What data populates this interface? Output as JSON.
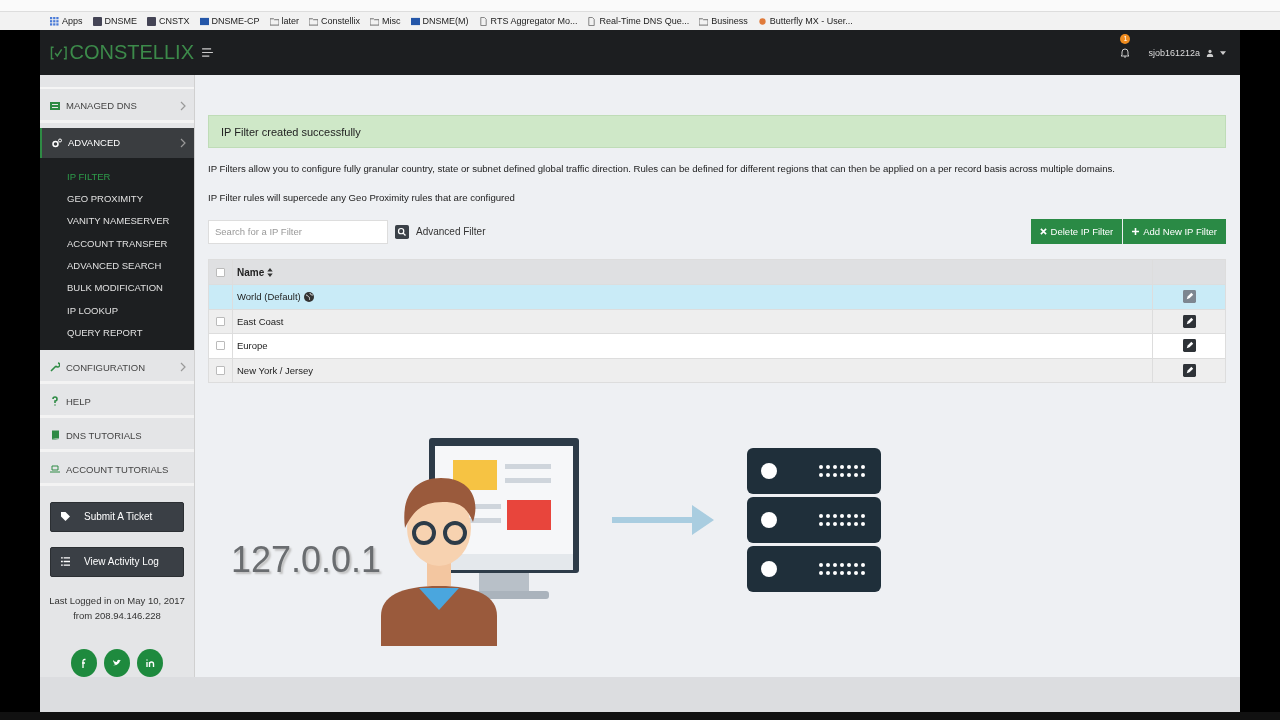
{
  "bookmarks": [
    {
      "label": "Apps",
      "kind": "apps"
    },
    {
      "label": "DNSME",
      "kind": "site"
    },
    {
      "label": "CNSTX",
      "kind": "site"
    },
    {
      "label": "DNSME-CP",
      "kind": "flag"
    },
    {
      "label": "later",
      "kind": "folder"
    },
    {
      "label": "Constellix",
      "kind": "folder"
    },
    {
      "label": "Misc",
      "kind": "folder"
    },
    {
      "label": "DNSME(M)",
      "kind": "flag"
    },
    {
      "label": "RTS Aggregator Mo...",
      "kind": "page"
    },
    {
      "label": "Real-Time DNS Que...",
      "kind": "page"
    },
    {
      "label": "Business",
      "kind": "folder"
    },
    {
      "label": "Butterfly MX - User...",
      "kind": "leaf"
    }
  ],
  "header": {
    "logo": "CONSTELLIX",
    "notification_count": "1",
    "user": "sjob161212a"
  },
  "sidebar": {
    "items": [
      {
        "label": "MANAGED DNS",
        "kind": "dns",
        "selected": false,
        "arrow": true
      },
      {
        "label": "ADVANCED",
        "kind": "advanced",
        "selected": true,
        "arrow": true,
        "children": [
          {
            "label": "IP FILTER",
            "selected": true
          },
          {
            "label": "GEO PROXIMITY",
            "selected": false
          },
          {
            "label": "VANITY NAMESERVER",
            "selected": false
          },
          {
            "label": "ACCOUNT TRANSFER",
            "selected": false
          },
          {
            "label": "ADVANCED SEARCH",
            "selected": false
          },
          {
            "label": "BULK MODIFICATION",
            "selected": false
          },
          {
            "label": "IP LOOKUP",
            "selected": false
          },
          {
            "label": "QUERY REPORT",
            "selected": false
          }
        ]
      },
      {
        "label": "CONFIGURATION",
        "kind": "config",
        "selected": false,
        "arrow": true
      },
      {
        "label": "HELP",
        "kind": "help",
        "selected": false,
        "arrow": false
      },
      {
        "label": "DNS TUTORIALS",
        "kind": "book",
        "selected": false,
        "arrow": false
      },
      {
        "label": "ACCOUNT TUTORIALS",
        "kind": "laptop",
        "selected": false,
        "arrow": false
      }
    ],
    "buttons": [
      {
        "label": "Submit A Ticket",
        "kind": "ticket"
      },
      {
        "label": "View Activity Log",
        "kind": "log"
      }
    ],
    "last_login": "Last Logged in on May 10, 2017 from 208.94.146.228",
    "social": [
      {
        "kind": "facebook"
      },
      {
        "kind": "twitter"
      },
      {
        "kind": "linkedin"
      }
    ]
  },
  "alert": "IP Filter created successfully",
  "description": [
    "IP Filters allow you to configure fully granular country, state or subnet defined global traffic direction. Rules can be defined for different regions that can then be applied on a per record basis across multiple domains.",
    "IP Filter rules will supercede any Geo Proximity rules that are configured"
  ],
  "search": {
    "placeholder": "Search for a IP Filter"
  },
  "advanced_filter": "Advanced Filter",
  "actions": [
    {
      "label": "Delete IP Filter",
      "kind": "delete"
    },
    {
      "label": "Add New IP Filter",
      "kind": "add"
    }
  ],
  "table": {
    "columns": [
      "Name"
    ],
    "all_checked": false,
    "rows": [
      {
        "name": "World (Default)",
        "default": true,
        "selected": true
      },
      {
        "name": "East Coast",
        "default": false,
        "selected": false,
        "checked": false
      },
      {
        "name": "Europe",
        "default": false,
        "selected": false,
        "checked": false
      },
      {
        "name": "New York / Jersey",
        "default": false,
        "selected": false,
        "checked": false
      }
    ]
  },
  "illustration": {
    "ip": "127.0.0.1"
  }
}
